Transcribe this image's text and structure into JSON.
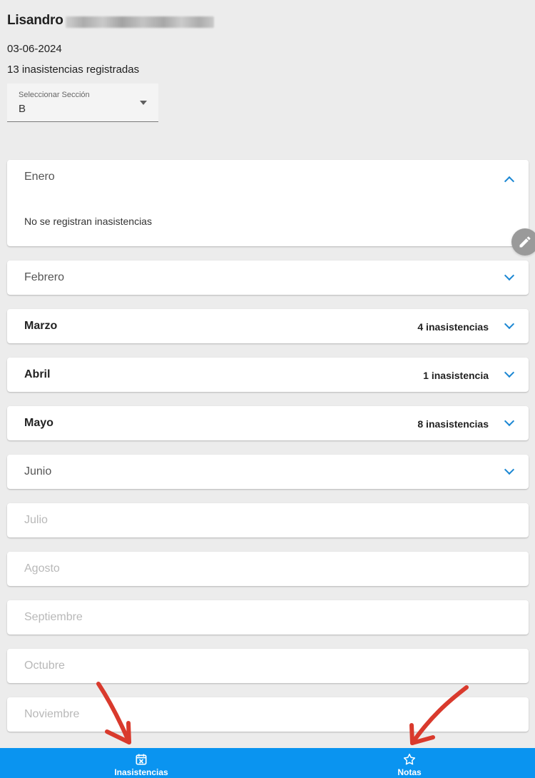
{
  "student": {
    "name": "Lisandro"
  },
  "header": {
    "date": "03-06-2024",
    "summary": "13 inasistencias registradas"
  },
  "section_select": {
    "label": "Seleccionar Sección",
    "value": "B",
    "icon": "dropdown-icon"
  },
  "months": [
    {
      "name": "Enero",
      "state": "expanded",
      "content": "No se registran inasistencias",
      "icon": "chevron-up-icon"
    },
    {
      "name": "Febrero",
      "state": "collapsed",
      "icon": "chevron-down-icon"
    },
    {
      "name": "Marzo",
      "state": "collapsed",
      "count": "4 inasistencias",
      "icon": "chevron-down-icon"
    },
    {
      "name": "Abril",
      "state": "collapsed",
      "count": "1 inasistencia",
      "icon": "chevron-down-icon"
    },
    {
      "name": "Mayo",
      "state": "collapsed",
      "count": "8 inasistencias",
      "icon": "chevron-down-icon"
    },
    {
      "name": "Junio",
      "state": "collapsed",
      "icon": "chevron-down-icon"
    },
    {
      "name": "Julio",
      "state": "disabled"
    },
    {
      "name": "Agosto",
      "state": "disabled"
    },
    {
      "name": "Septiembre",
      "state": "disabled"
    },
    {
      "name": "Octubre",
      "state": "disabled"
    },
    {
      "name": "Noviembre",
      "state": "disabled"
    }
  ],
  "fab": {
    "icon": "pencil-icon"
  },
  "bottom_nav": {
    "items": [
      {
        "label": "Inasistencias",
        "icon": "calendar-x-icon"
      },
      {
        "label": "Notas",
        "icon": "star-icon"
      }
    ]
  },
  "colors": {
    "background": "#ececec",
    "card": "#ffffff",
    "accent": "#1b87d3",
    "bottom_nav": "#0a94f0",
    "annotation_arrow": "#d93a2d"
  }
}
